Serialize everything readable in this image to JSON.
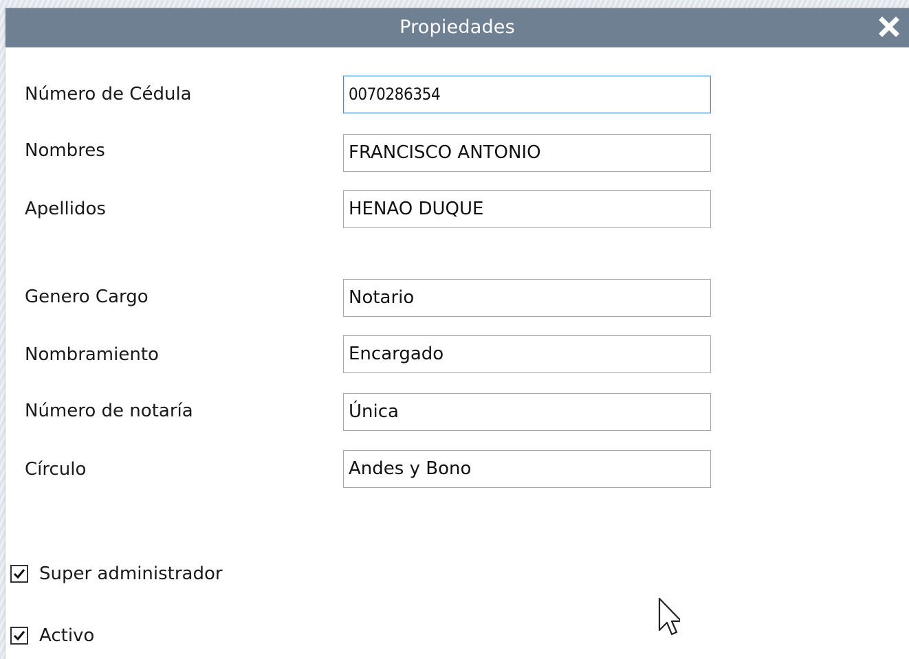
{
  "dialog": {
    "title": "Propiedades",
    "close_icon": "close-icon"
  },
  "fields": [
    {
      "label": "Número de Cédula",
      "value": "0070286354",
      "focused": true
    },
    {
      "label": "Nombres",
      "value": "FRANCISCO ANTONIO"
    },
    {
      "label": "Apellidos",
      "value": "HENAO DUQUE"
    },
    {
      "label": "Genero Cargo",
      "value": "Notario"
    },
    {
      "label": "Nombramiento",
      "value": "Encargado"
    },
    {
      "label": "Número de notaría",
      "value": "Única"
    },
    {
      "label": "Círculo",
      "value": "Andes y Bono"
    }
  ],
  "checkboxes": [
    {
      "label": "Super administrador",
      "checked": true
    },
    {
      "label": "Activo",
      "checked": true
    }
  ],
  "colors": {
    "titlebar": "#6e8091",
    "focus_border": "#4a90d9"
  }
}
